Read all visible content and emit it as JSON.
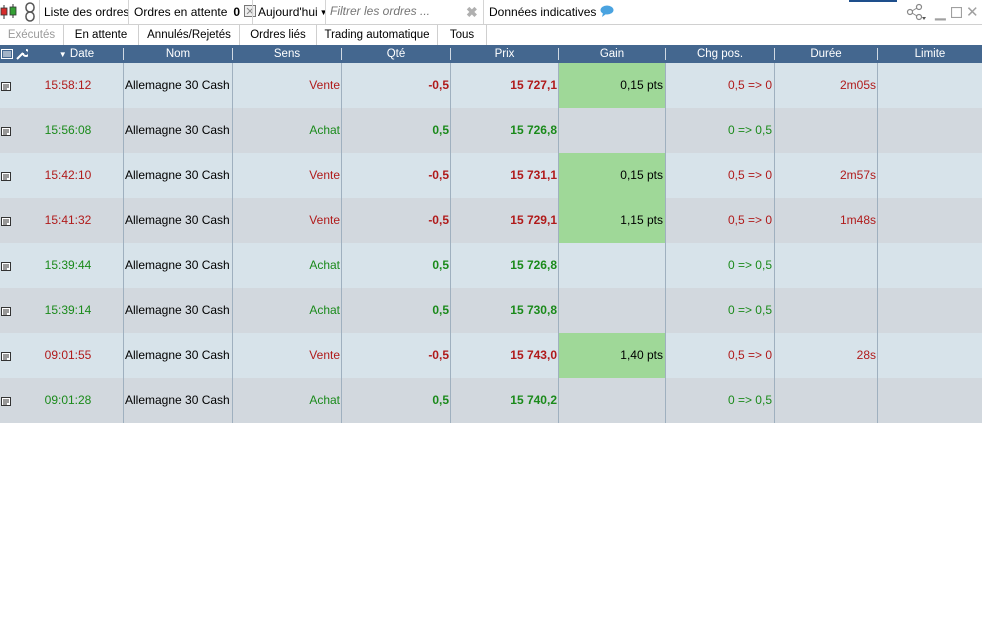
{
  "toolbar": {
    "orders_list_label": "Liste des ordres",
    "pending_label": "Ordres en attente",
    "pending_count": "0",
    "period_label": "Aujourd'hui",
    "filter_placeholder": "Filtrer les ordres ...",
    "indicative_label": "Données indicatives"
  },
  "tabs": [
    {
      "label": "Exécutés"
    },
    {
      "label": "En attente"
    },
    {
      "label": "Annulés/Rejetés"
    },
    {
      "label": "Ordres liés"
    },
    {
      "label": "Trading automatique"
    },
    {
      "label": "Tous"
    }
  ],
  "columns": {
    "date": "Date",
    "nom": "Nom",
    "sens": "Sens",
    "qte": "Qté",
    "prix": "Prix",
    "gain": "Gain",
    "chg": "Chg pos.",
    "duree": "Durée",
    "limite": "Limite"
  },
  "rows": [
    {
      "date": "15:58:12",
      "nom": "Allemagne 30 Cash ...",
      "sens": "Vente",
      "qte": "-0,5",
      "prix": "15 727,1",
      "gain": "0,15 pts",
      "chg": "0,5 => 0",
      "duree": "2m05s",
      "limite": "",
      "side": "sell"
    },
    {
      "date": "15:56:08",
      "nom": "Allemagne 30 Cash ...",
      "sens": "Achat",
      "qte": "0,5",
      "prix": "15 726,8",
      "gain": "",
      "chg": "0 => 0,5",
      "duree": "",
      "limite": "",
      "side": "buy"
    },
    {
      "date": "15:42:10",
      "nom": "Allemagne 30 Cash ...",
      "sens": "Vente",
      "qte": "-0,5",
      "prix": "15 731,1",
      "gain": "0,15 pts",
      "chg": "0,5 => 0",
      "duree": "2m57s",
      "limite": "",
      "side": "sell"
    },
    {
      "date": "15:41:32",
      "nom": "Allemagne 30 Cash ...",
      "sens": "Vente",
      "qte": "-0,5",
      "prix": "15 729,1",
      "gain": "1,15 pts",
      "chg": "0,5 => 0",
      "duree": "1m48s",
      "limite": "",
      "side": "sell"
    },
    {
      "date": "15:39:44",
      "nom": "Allemagne 30 Cash ...",
      "sens": "Achat",
      "qte": "0,5",
      "prix": "15 726,8",
      "gain": "",
      "chg": "0 => 0,5",
      "duree": "",
      "limite": "",
      "side": "buy"
    },
    {
      "date": "15:39:14",
      "nom": "Allemagne 30 Cash ...",
      "sens": "Achat",
      "qte": "0,5",
      "prix": "15 730,8",
      "gain": "",
      "chg": "0 => 0,5",
      "duree": "",
      "limite": "",
      "side": "buy"
    },
    {
      "date": "09:01:55",
      "nom": "Allemagne 30 Cash ...",
      "sens": "Vente",
      "qte": "-0,5",
      "prix": "15 743,0",
      "gain": "1,40 pts",
      "chg": "0,5 => 0",
      "duree": "28s",
      "limite": "",
      "side": "sell"
    },
    {
      "date": "09:01:28",
      "nom": "Allemagne 30 Cash ...",
      "sens": "Achat",
      "qte": "0,5",
      "prix": "15 740,2",
      "gain": "",
      "chg": "0 => 0,5",
      "duree": "",
      "limite": "",
      "side": "buy"
    }
  ],
  "colors": {
    "header_bg": "#44678f",
    "row_light": "#d7e3ea",
    "row_dark": "#d2d8de",
    "gain_bg": "#9fd898",
    "buy": "#1a8a1a",
    "sell": "#b01a1a"
  },
  "icons": [
    "candlestick-icon",
    "link-icon",
    "calendar-icon",
    "clear-filter-icon",
    "chat-bubble-icon",
    "share-icon",
    "minimize-icon",
    "maximize-icon",
    "close-icon",
    "columns-icon",
    "wrench-icon",
    "sort-desc-icon",
    "order-detail-icon"
  ]
}
